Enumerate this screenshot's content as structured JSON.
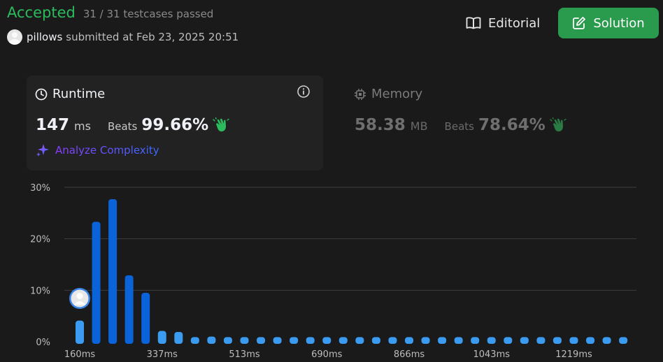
{
  "status": {
    "label": "Accepted",
    "testcases": "31 / 31 testcases passed"
  },
  "submission": {
    "user": "pillows",
    "submitted_at": "submitted at Feb 23, 2025 20:51"
  },
  "buttons": {
    "editorial": "Editorial",
    "solution": "Solution"
  },
  "runtime": {
    "title": "Runtime",
    "value": "147",
    "unit": "ms",
    "beats_label": "Beats",
    "beats_value": "99.66%",
    "analyze_label": "Analyze Complexity"
  },
  "memory": {
    "title": "Memory",
    "value": "58.38",
    "unit": "MB",
    "beats_label": "Beats",
    "beats_value": "78.64%"
  },
  "icons": [
    "clock-icon",
    "info-icon",
    "memory-chip-icon",
    "clap-icon",
    "sparkle-icon",
    "book-icon",
    "edit-icon",
    "avatar"
  ],
  "colors": {
    "accepted": "#2cbb5d",
    "solution_bg": "#2a9b4c",
    "bar_highlight": "#0a63d8",
    "bar_normal": "#3a9bf0"
  },
  "chart_data": {
    "type": "bar",
    "title": "",
    "ylabel": "",
    "xlabel": "",
    "y_ticks": [
      "30%",
      "20%",
      "10%",
      "0%"
    ],
    "ylim": [
      0,
      30
    ],
    "x_tick_labels": [
      "160ms",
      "337ms",
      "513ms",
      "690ms",
      "866ms",
      "1043ms",
      "1219ms"
    ],
    "values": [
      4.1,
      23.3,
      27.7,
      12.9,
      9.5,
      2.1,
      1.9,
      0.9,
      1.0,
      0.9,
      0.9,
      0.9,
      0.9,
      0.9,
      0.9,
      0.9,
      0.9,
      0.9,
      0.9,
      0.9,
      0.9,
      0.9,
      0.9,
      0.9,
      0.9,
      0.9,
      0.9,
      0.9,
      0.9,
      0.9,
      0.9,
      0.9,
      0.9,
      0.9
    ],
    "highlighted": [
      1,
      2,
      3,
      4
    ],
    "user_bar_index": 0,
    "grid": true
  }
}
